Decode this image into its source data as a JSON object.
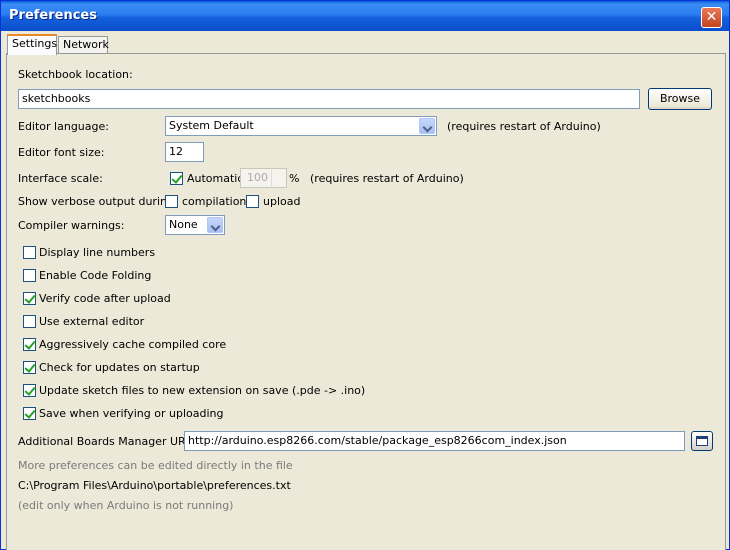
{
  "window": {
    "title": "Preferences",
    "close_glyph": "✕"
  },
  "tabs": [
    {
      "label": "Settings",
      "active": true
    },
    {
      "label": "Network",
      "active": false
    }
  ],
  "sketchbook": {
    "label": "Sketchbook location:",
    "value": "sketchbooks",
    "browse_label": "Browse"
  },
  "editor_language": {
    "label": "Editor language:",
    "value": "System Default",
    "note": "(requires restart of Arduino)"
  },
  "editor_font_size": {
    "label": "Editor font size:",
    "value": "12"
  },
  "interface_scale": {
    "label": "Interface scale:",
    "automatic_label": "Automatic",
    "automatic_checked": true,
    "value": "100",
    "unit": "%",
    "note": "(requires restart of Arduino)"
  },
  "verbose": {
    "label": "Show verbose output during:",
    "compilation_label": "compilation",
    "compilation_checked": false,
    "upload_label": "upload",
    "upload_checked": false
  },
  "compiler_warnings": {
    "label": "Compiler warnings:",
    "value": "None"
  },
  "checkboxes": [
    {
      "label": "Display line numbers",
      "checked": false
    },
    {
      "label": "Enable Code Folding",
      "checked": false
    },
    {
      "label": "Verify code after upload",
      "checked": true
    },
    {
      "label": "Use external editor",
      "checked": false
    },
    {
      "label": "Aggressively cache compiled core",
      "checked": true
    },
    {
      "label": "Check for updates on startup",
      "checked": true
    },
    {
      "label": "Update sketch files to new extension on save (.pde -> .ino)",
      "checked": true
    },
    {
      "label": "Save when verifying or uploading",
      "checked": true
    }
  ],
  "boards_manager": {
    "label": "Additional Boards Manager URLs:",
    "value": "http://arduino.esp8266.com/stable/package_esp8266com_index.json"
  },
  "footer": {
    "more_prefs": "More preferences can be edited directly in the file",
    "path": "C:\\Program Files\\Arduino\\portable\\preferences.txt",
    "edit_note": "(edit only when Arduino is not running)"
  },
  "colors": {
    "titlebar": "#2b7df0",
    "background": "#ece9d8",
    "active_tab_accent": "#e68b2c",
    "check": "#21a121"
  }
}
